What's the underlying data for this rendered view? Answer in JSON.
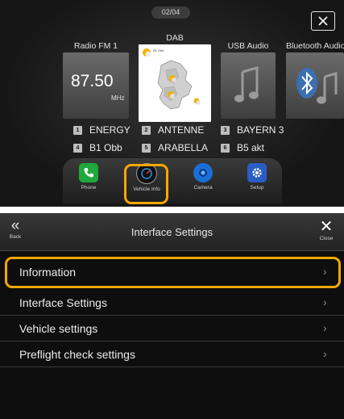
{
  "top_screen": {
    "page_indicator": "02/04",
    "sources": [
      {
        "id": "radio",
        "label": "Radio FM 1",
        "frequency": "87.50",
        "unit": "MHz"
      },
      {
        "id": "dab",
        "label": "DAB",
        "map_tag": "B1 Obb"
      },
      {
        "id": "usb",
        "label": "USB Audio"
      },
      {
        "id": "bluetooth",
        "label": "Bluetooth Audio"
      }
    ],
    "presets": [
      {
        "num": "1",
        "name": "ENERGY"
      },
      {
        "num": "2",
        "name": "ANTENNE"
      },
      {
        "num": "3",
        "name": "BAYERN 3"
      },
      {
        "num": "4",
        "name": "B1 Obb"
      },
      {
        "num": "5",
        "name": "ARABELLA"
      },
      {
        "num": "6",
        "name": "B5 akt"
      }
    ],
    "dock": [
      {
        "label": "Phone",
        "icon": "phone-icon",
        "color": "#1fa83c"
      },
      {
        "label": "Vehicle Info",
        "icon": "gauge-icon",
        "color": "#101010"
      },
      {
        "label": "Camera",
        "icon": "camera-icon",
        "color": "#1a6fd6"
      },
      {
        "label": "Setup",
        "icon": "gear-icon",
        "color": "#2a5dc4"
      }
    ]
  },
  "bottom_screen": {
    "back_label": "Back",
    "title": "Interface Settings",
    "close_label": "Close",
    "items": [
      {
        "label": "Information"
      },
      {
        "label": "Interface Settings"
      },
      {
        "label": "Vehicle settings"
      },
      {
        "label": "Preflight check settings"
      }
    ]
  },
  "highlight_color": "#f5a800"
}
